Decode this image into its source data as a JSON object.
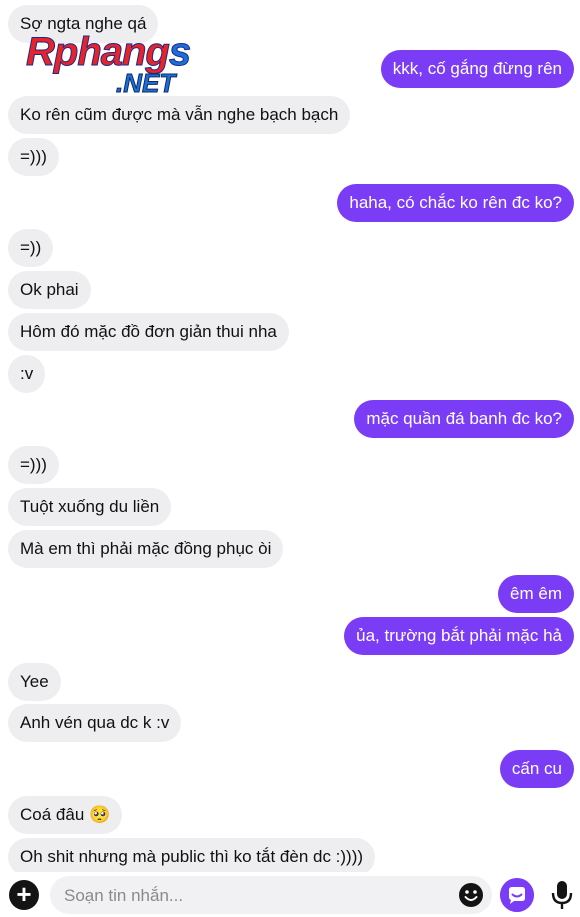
{
  "watermark": {
    "word": "Rphang",
    "letter": "s",
    "suffix": ".NET"
  },
  "messages": [
    {
      "side": "in",
      "text": "Sợ ngta nghe qá"
    },
    {
      "side": "out",
      "text": "kkk, cố gắng đừng rên"
    },
    {
      "side": "in",
      "text": "Ko rên cũm được mà vẫn nghe bạch bạch"
    },
    {
      "side": "in",
      "text": "=)))"
    },
    {
      "side": "out",
      "text": "haha, có chắc ko rên đc ko?"
    },
    {
      "side": "in",
      "text": "=))"
    },
    {
      "side": "in",
      "text": "Ok phai"
    },
    {
      "side": "in",
      "text": "Hôm đó mặc đồ đơn giản thui nha"
    },
    {
      "side": "in",
      "text": ":v"
    },
    {
      "side": "out",
      "text": "mặc quần đá banh đc ko?"
    },
    {
      "side": "in",
      "text": "=)))"
    },
    {
      "side": "in",
      "text": "Tuột xuống du liền"
    },
    {
      "side": "in",
      "text": "Mà em thì phải mặc đồng phục òi"
    },
    {
      "side": "out",
      "text": "êm êm"
    },
    {
      "side": "out",
      "text": "ủa, trường bắt phải mặc hả"
    },
    {
      "side": "in",
      "text": "Yee"
    },
    {
      "side": "in",
      "text": "Anh vén qua dc k :v"
    },
    {
      "side": "out",
      "text": "cấn cu"
    },
    {
      "side": "in",
      "text": "Coá đâu 🥺"
    },
    {
      "side": "in",
      "text": "Oh shit nhưng mà public thì ko tắt đèn dc :))))"
    }
  ],
  "composer": {
    "add_icon": "plus-circle-icon",
    "placeholder": "Soạn tin nhắn...",
    "value": "",
    "emoji_icon": "smiley-icon",
    "bot_icon": "chatbot-icon",
    "mic_icon": "microphone-icon"
  },
  "colors": {
    "outgoing": "#7b3cf6",
    "incoming": "#eeeef0"
  }
}
